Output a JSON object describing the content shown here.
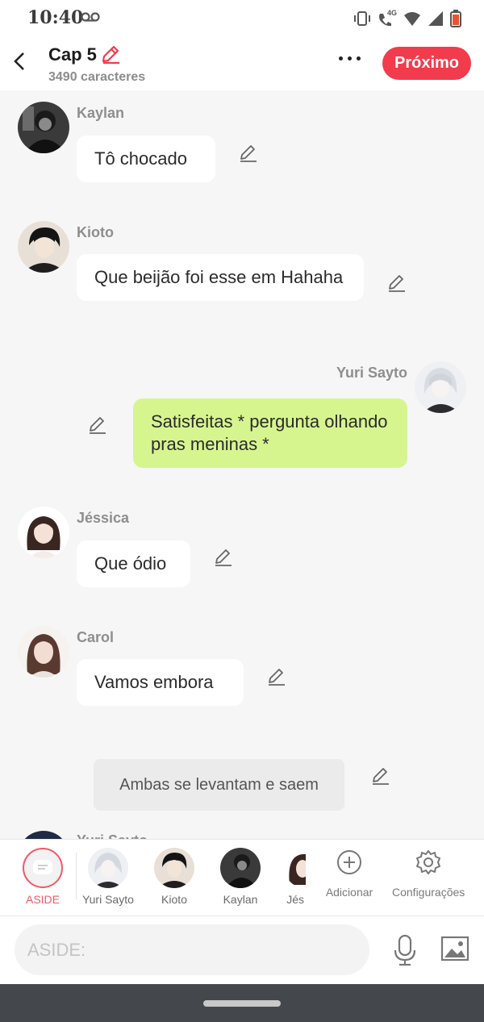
{
  "status": {
    "time": "10:40",
    "network_label": "4G"
  },
  "header": {
    "title": "Cap 5",
    "char_count": "3490 caracteres",
    "next_label": "Próximo"
  },
  "messages": [
    {
      "sender": "Kaylan",
      "text": "Tô chocado",
      "side": "left"
    },
    {
      "sender": "Kioto",
      "text": "Que beijão foi esse em Hahaha",
      "side": "left"
    },
    {
      "sender": "Yuri Sayto",
      "text": "Satisfeitas * pergunta olhando pras meninas *",
      "side": "right"
    },
    {
      "sender": "Jéssica",
      "text": "Que ódio",
      "side": "left"
    },
    {
      "sender": "Carol",
      "text": "Vamos embora",
      "side": "left"
    },
    {
      "sender": "",
      "text": "Ambas se levantam e saem",
      "side": "center"
    },
    {
      "sender": "Yuri Sayto",
      "text": "",
      "side": "left"
    }
  ],
  "characters": [
    {
      "label": "ASIDE"
    },
    {
      "label": "Yuri Sayto"
    },
    {
      "label": "Kioto"
    },
    {
      "label": "Kaylan"
    },
    {
      "label": "Jés"
    }
  ],
  "tools": {
    "add_label": "Adicionar",
    "settings_label": "Configurações"
  },
  "input": {
    "placeholder": "ASIDE:"
  },
  "colors": {
    "accent": "#f23b4c",
    "my_bubble": "#d7f58f",
    "aside": "#f05a66"
  }
}
